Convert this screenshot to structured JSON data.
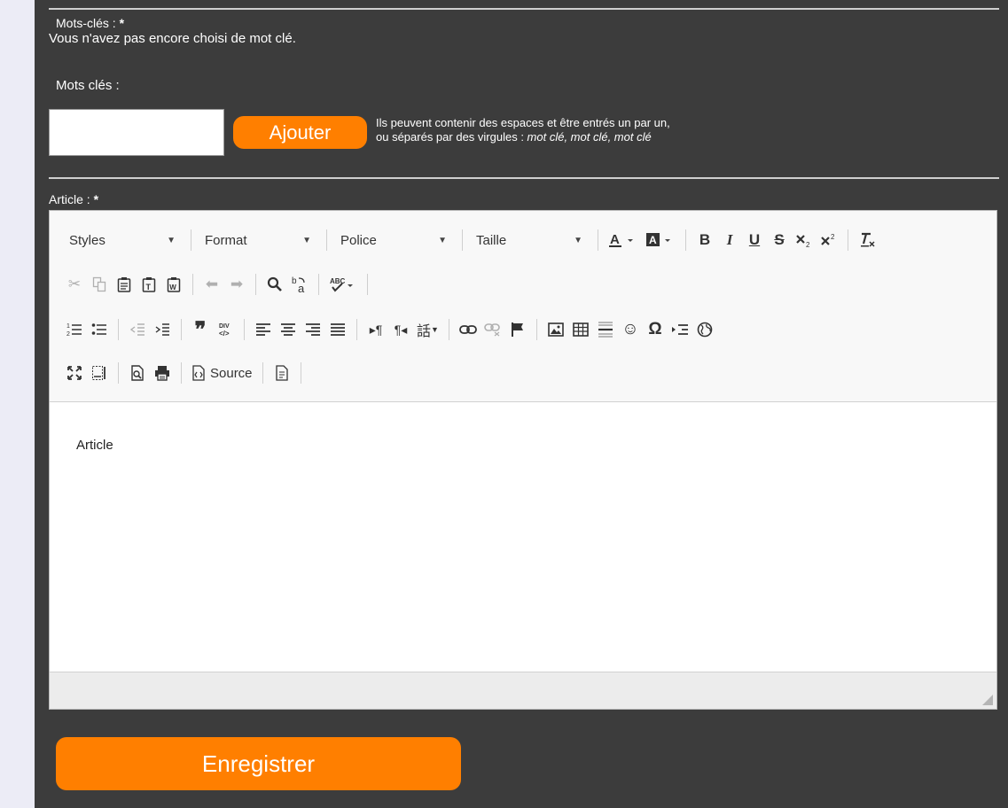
{
  "keywords": {
    "section_label": "Mots-clés :",
    "required_mark": "*",
    "empty_message": "Vous n'avez pas encore choisi de mot clé.",
    "input_label": "Mots clés :",
    "input_value": "",
    "add_button": "Ajouter",
    "hint_line1": "Ils peuvent contenir des espaces et être entrés un par un,",
    "hint_line2_prefix": "ou séparés par des virgules : ",
    "hint_line2_example": "mot clé, mot clé, mot clé"
  },
  "article": {
    "section_label": "Article :",
    "required_mark": "*",
    "content": "Article"
  },
  "toolbar": {
    "styles": "Styles",
    "format": "Format",
    "font": "Police",
    "size": "Taille",
    "bold": "B",
    "italic": "I",
    "underline": "U",
    "strike": "S",
    "source": "Source"
  },
  "form": {
    "save_button": "Enregistrer"
  }
}
